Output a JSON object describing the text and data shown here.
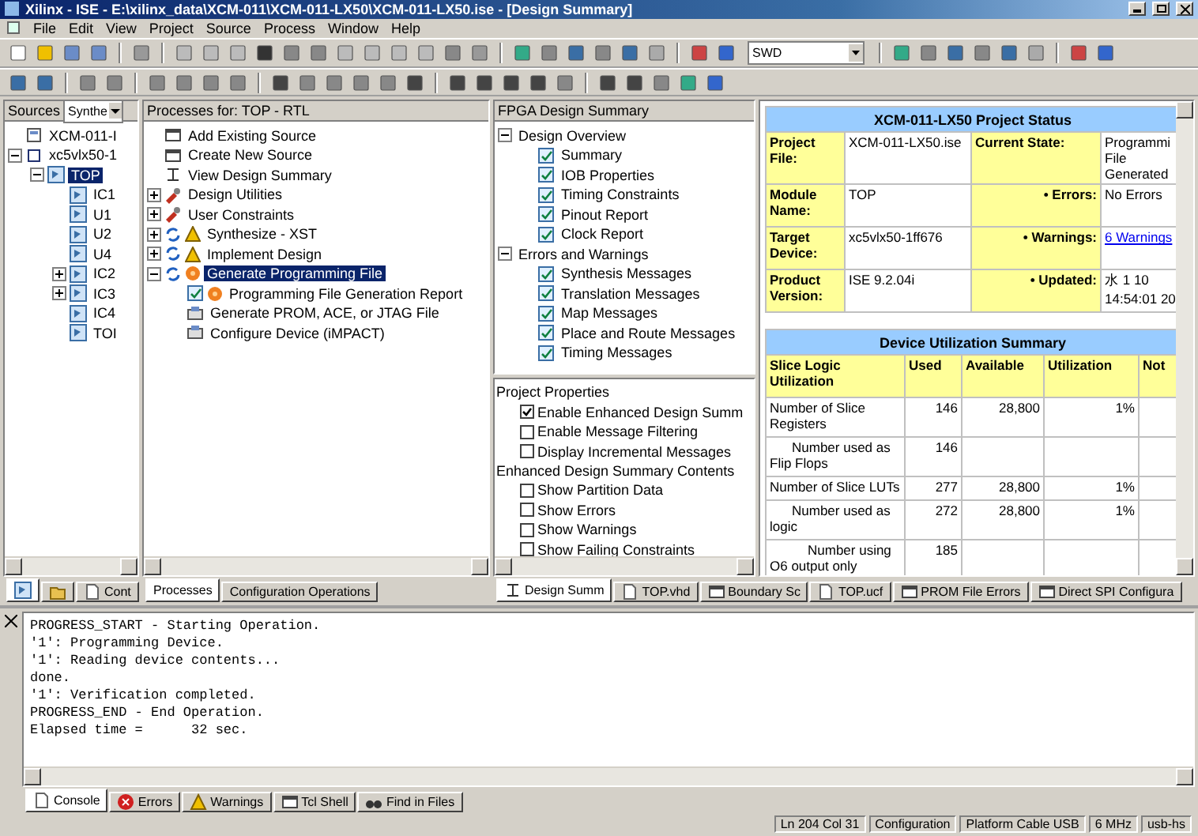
{
  "window": {
    "title": "Xilinx - ISE - E:\\xilinx_data\\XCM-011\\XCM-011-LX50\\XCM-011-LX50.ise - [Design Summary]"
  },
  "menu": [
    "File",
    "Edit",
    "View",
    "Project",
    "Source",
    "Process",
    "Window",
    "Help"
  ],
  "toolbar": {
    "search_value": "SWD"
  },
  "sources": {
    "label": "Sources",
    "view": "Synthe",
    "tree": [
      {
        "label": "XCM-011-I",
        "kind": "project",
        "selected": false
      },
      {
        "label": "xc5vlx50-1",
        "kind": "chip",
        "selected": false,
        "expanded": true,
        "children": [
          {
            "label": "TOP",
            "kind": "module",
            "selected": true,
            "expanded": true,
            "children": [
              {
                "label": "IC1",
                "kind": "module",
                "selected": false
              },
              {
                "label": "U1",
                "kind": "module",
                "selected": false
              },
              {
                "label": "U2",
                "kind": "module",
                "selected": false
              },
              {
                "label": "U4",
                "kind": "module",
                "selected": false
              },
              {
                "label": "IC2",
                "kind": "module",
                "selected": false,
                "expanded": false
              },
              {
                "label": "IC3",
                "kind": "module",
                "selected": false,
                "expanded": false
              },
              {
                "label": "IC4",
                "kind": "module",
                "selected": false
              },
              {
                "label": "TOI",
                "kind": "module",
                "selected": false
              }
            ]
          }
        ]
      }
    ],
    "tabs": [
      {
        "kind": "module",
        "selected": true
      },
      {
        "kind": "folder",
        "selected": false
      },
      {
        "kind": "doc",
        "selected": false,
        "label": "Cont"
      }
    ]
  },
  "processes": {
    "header": "Processes for: TOP - RTL",
    "tree": [
      {
        "label": "Add Existing Source",
        "kind": "window",
        "selected": false
      },
      {
        "label": "Create New Source",
        "kind": "window",
        "selected": false
      },
      {
        "label": "View Design Summary",
        "kind": "summary",
        "selected": false
      },
      {
        "label": "Design Utilities",
        "kind": "utility",
        "selected": false,
        "expanded": false
      },
      {
        "label": "User Constraints",
        "kind": "utility",
        "selected": false,
        "expanded": false
      },
      {
        "label": "Synthesize - XST",
        "kind": "sync_warning",
        "selected": false,
        "expanded": false
      },
      {
        "label": "Implement Design",
        "kind": "sync_warning",
        "selected": false,
        "expanded": false
      },
      {
        "label": "Generate Programming File",
        "kind": "sync_pending",
        "selected": true,
        "expanded": true,
        "children": [
          {
            "label": "Programming File Generation Report",
            "kind": "report_pending",
            "selected": false
          },
          {
            "label": "Generate PROM, ACE, or JTAG File",
            "kind": "tool",
            "selected": false
          },
          {
            "label": "Configure Device (iMPACT)",
            "kind": "tool",
            "selected": false
          }
        ]
      }
    ],
    "tabs": [
      {
        "label": "Processes",
        "selected": true
      },
      {
        "label": "Configuration Operations",
        "selected": false
      }
    ]
  },
  "summary_nav": {
    "header": "FPGA Design Summary",
    "tree": [
      {
        "label": "Design Overview",
        "selected": false,
        "expanded": true,
        "children": [
          {
            "label": "Summary",
            "kind": "report",
            "selected": false
          },
          {
            "label": "IOB Properties",
            "kind": "report",
            "selected": false
          },
          {
            "label": "Timing Constraints",
            "kind": "report",
            "selected": false
          },
          {
            "label": "Pinout Report",
            "kind": "report",
            "selected": false
          },
          {
            "label": "Clock Report",
            "kind": "report",
            "selected": false
          }
        ]
      },
      {
        "label": "Errors and Warnings",
        "selected": false,
        "expanded": true,
        "children": [
          {
            "label": "Synthesis Messages",
            "kind": "report",
            "selected": false
          },
          {
            "label": "Translation Messages",
            "kind": "report",
            "selected": false
          },
          {
            "label": "Map Messages",
            "kind": "report",
            "selected": false
          },
          {
            "label": "Place and Route Messages",
            "kind": "report",
            "selected": false
          },
          {
            "label": "Timing Messages",
            "kind": "report",
            "selected": false
          }
        ]
      }
    ]
  },
  "properties": [
    {
      "title": "Project Properties",
      "items": [
        {
          "label": "Enable Enhanced Design Summ",
          "checked": true
        },
        {
          "label": "Enable Message Filtering",
          "checked": false
        },
        {
          "label": "Display Incremental Messages",
          "checked": false
        }
      ]
    },
    {
      "title": "Enhanced Design Summary Contents",
      "items": [
        {
          "label": "Show Partition Data",
          "checked": false
        },
        {
          "label": "Show Errors",
          "checked": false
        },
        {
          "label": "Show Warnings",
          "checked": false
        },
        {
          "label": "Show Failing Constraints",
          "checked": false
        }
      ]
    }
  ],
  "project_status": {
    "title": "XCM-011-LX50 Project Status",
    "rows": [
      {
        "label": "Project File:",
        "value": "XCM-011-LX50.ise",
        "state_label": "Current State:",
        "state_value": "Programmi File Generated",
        "link": false
      },
      {
        "label": "Module Name:",
        "value": "TOP",
        "state_label": "• Errors:",
        "state_value": "No Errors",
        "link": false
      },
      {
        "label": "Target Device:",
        "value": "xc5vlx50-1ff676",
        "state_label": "• Warnings:",
        "state_value": "6 Warnings",
        "link": true
      },
      {
        "label": "Product Version:",
        "value": "ISE 9.2.04i",
        "state_label": "• Updated:",
        "state_value": "水 1 10 14:54:01 20",
        "link": false
      }
    ]
  },
  "utilization": {
    "title": "Device Utilization Summary",
    "columns": [
      "Slice Logic Utilization",
      "Used",
      "Available",
      "Utilization",
      "Not"
    ],
    "rows": [
      {
        "kind": "main",
        "cells": [
          "Number of Slice Registers",
          "146",
          "28,800",
          "1%"
        ]
      },
      {
        "kind": "sub",
        "cells": [
          "Number used as Flip Flops",
          "146"
        ]
      },
      {
        "kind": "main",
        "cells": [
          "Number of Slice LUTs",
          "277",
          "28,800",
          "1%"
        ]
      },
      {
        "kind": "sub",
        "cells": [
          "Number used as logic",
          "272",
          "28,800",
          "1%"
        ]
      },
      {
        "kind": "subsub",
        "cells": [
          "Number using O6 output only",
          "185"
        ]
      }
    ]
  },
  "doc_tabs": [
    {
      "label": "Design Summ",
      "kind": "summary",
      "selected": true
    },
    {
      "label": "TOP.vhd",
      "kind": "doc",
      "selected": false
    },
    {
      "label": "Boundary Sc",
      "kind": "window",
      "selected": false
    },
    {
      "label": "TOP.ucf",
      "kind": "doc",
      "selected": false
    },
    {
      "label": "PROM File Errors",
      "kind": "window",
      "selected": false
    },
    {
      "label": "Direct SPI Configura",
      "kind": "window",
      "selected": false
    }
  ],
  "console": {
    "lines": [
      "PROGRESS_START - Starting Operation.",
      "'1': Programming Device.",
      "'1': Reading device contents...",
      "done.",
      "'1': Verification completed.",
      "PROGRESS_END - End Operation.",
      "Elapsed time =      32 sec."
    ],
    "tabs": [
      {
        "label": "Console",
        "kind": "doc",
        "selected": true
      },
      {
        "label": "Errors",
        "kind": "error",
        "selected": false
      },
      {
        "label": "Warnings",
        "kind": "warning",
        "selected": false
      },
      {
        "label": "Tcl Shell",
        "kind": "window",
        "selected": false
      },
      {
        "label": "Find in Files",
        "kind": "find",
        "selected": false
      }
    ]
  },
  "status_bar": [
    "Ln 204 Col 31",
    "Configuration",
    "Platform Cable USB",
    "6 MHz",
    "usb-hs"
  ]
}
